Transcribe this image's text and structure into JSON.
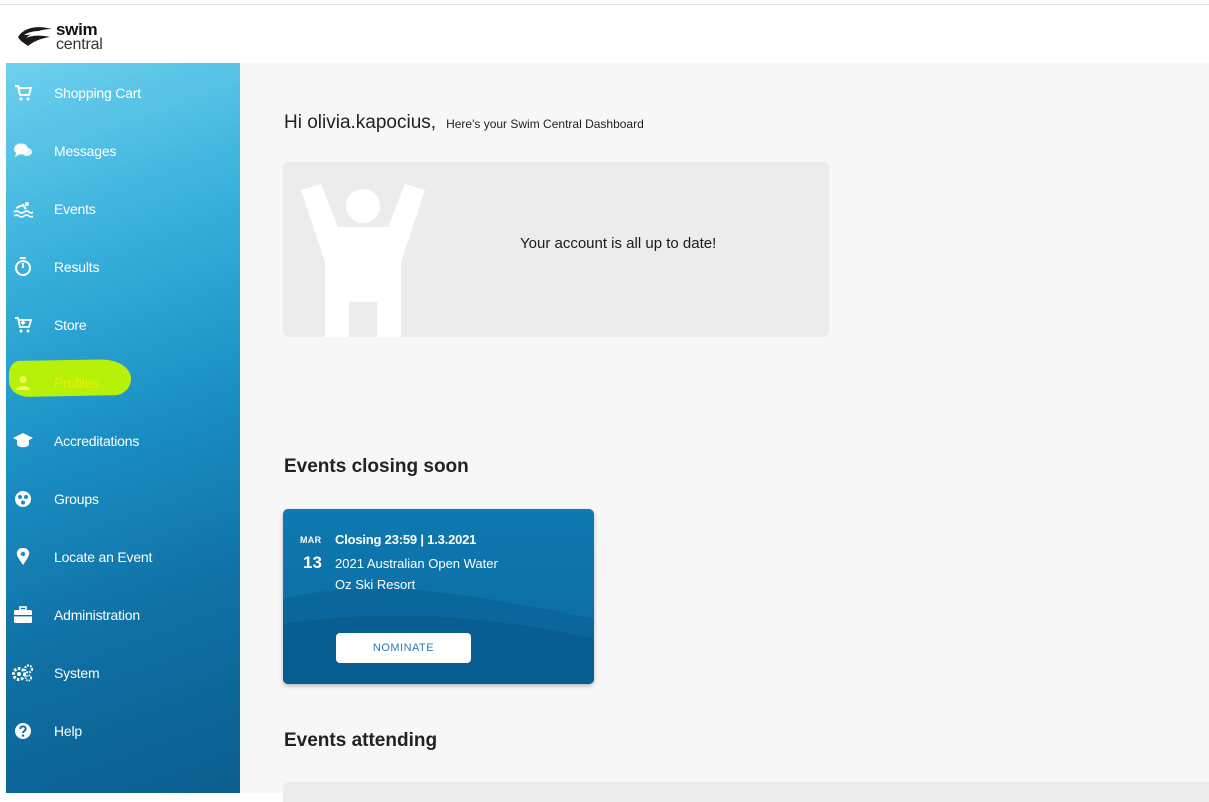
{
  "brand": {
    "word1": "swim",
    "word2": "central"
  },
  "sidebar": {
    "items": [
      {
        "label": "Shopping Cart",
        "icon": "shopping-cart-icon"
      },
      {
        "label": "Messages",
        "icon": "chat-bubbles-icon"
      },
      {
        "label": "Events",
        "icon": "swimmer-icon"
      },
      {
        "label": "Results",
        "icon": "stopwatch-icon"
      },
      {
        "label": "Store",
        "icon": "store-cart-icon"
      },
      {
        "label": "Profiles",
        "icon": "person-icon"
      },
      {
        "label": "Accreditations",
        "icon": "graduation-cap-icon"
      },
      {
        "label": "Groups",
        "icon": "group-icon"
      },
      {
        "label": "Locate an Event",
        "icon": "map-pin-icon"
      },
      {
        "label": "Administration",
        "icon": "briefcase-icon"
      },
      {
        "label": "System",
        "icon": "gears-icon"
      },
      {
        "label": "Help",
        "icon": "question-icon"
      }
    ],
    "highlight_color": "#b7f10a"
  },
  "main": {
    "greeting": "Hi olivia.kapocius,",
    "greeting_sub": "Here's your Swim Central Dashboard",
    "status_message": "Your account is all up to date!",
    "events_closing_title": "Events closing soon",
    "event": {
      "month": "MAR",
      "day": "13",
      "closing": "Closing  23:59 | 1.3.2021",
      "name": "2021 Australian Open Water",
      "venue": "Oz Ski Resort",
      "action": "NOMINATE"
    },
    "events_attending_title": "Events attending"
  },
  "colors": {
    "sidebar_top": "#6ed0ee",
    "sidebar_bottom": "#0b5f8f",
    "card_blue": "#0f79b0",
    "background": "#f7f7f7"
  }
}
